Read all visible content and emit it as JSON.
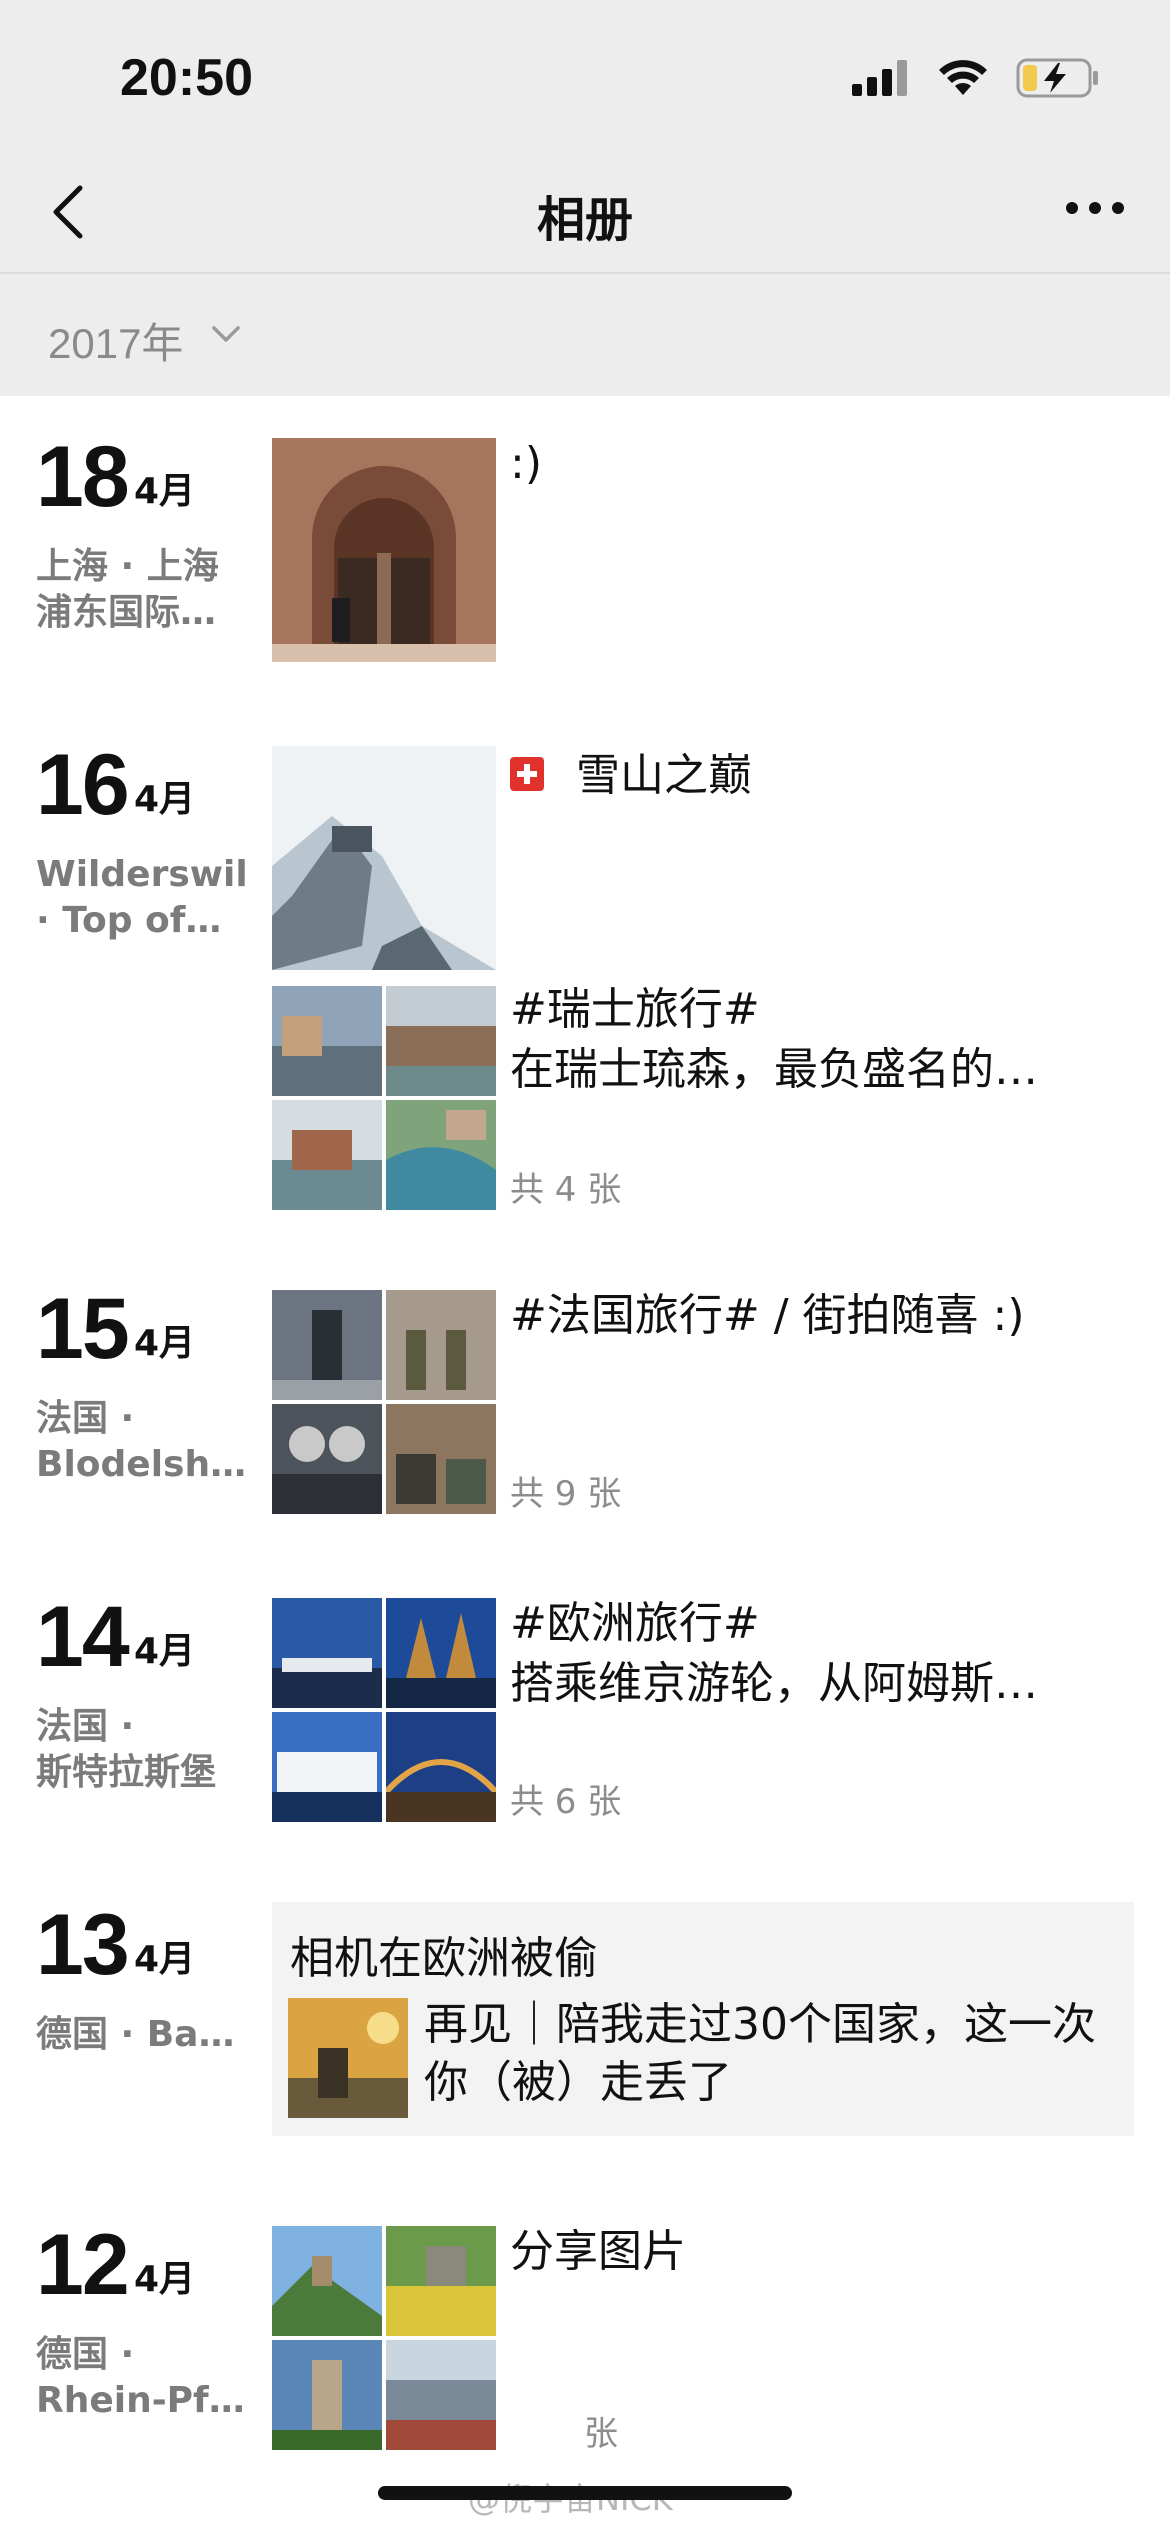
{
  "status": {
    "time": "20:50"
  },
  "nav": {
    "title": "相册"
  },
  "filter": {
    "year": "2017年"
  },
  "entries": [
    {
      "day": "18",
      "month": "4月",
      "location": "上海 · 上海\n浦东国际…",
      "caption": ":)"
    },
    {
      "day": "16",
      "month": "4月",
      "location": "Wilderswil\n· Top of…",
      "post1_caption": "雪山之巅",
      "post2_caption_line1": "#瑞士旅行#",
      "post2_caption_line2": "在瑞士琉森，最负盛名的…",
      "post2_count": "共 4 张"
    },
    {
      "day": "15",
      "month": "4月",
      "location": "法国 ·\nBlodelsh…",
      "caption": "#法国旅行#     / 街拍随喜 :)",
      "count": "共 9 张"
    },
    {
      "day": "14",
      "month": "4月",
      "location": "法国 ·\n斯特拉斯堡",
      "caption_line1": "#欧洲旅行#",
      "caption_line2": "搭乘维京游轮，从阿姆斯…",
      "count": "共 6 张"
    },
    {
      "day": "13",
      "month": "4月",
      "location": "德国 · Ba…",
      "article_title": "相机在欧洲被偷",
      "article_text": "再见｜陪我走过30个国家，这一次你（被）走丢了"
    },
    {
      "day": "12",
      "month": "4月",
      "location": "德国 ·\nRhein-Pf…",
      "caption": "分享图片",
      "count": "张"
    }
  ],
  "watermark": "@倪宇宙NICK",
  "colors": {
    "header_bg": "#ededed",
    "card_bg": "#f3f3f3",
    "muted_text": "#8c8c8c"
  }
}
